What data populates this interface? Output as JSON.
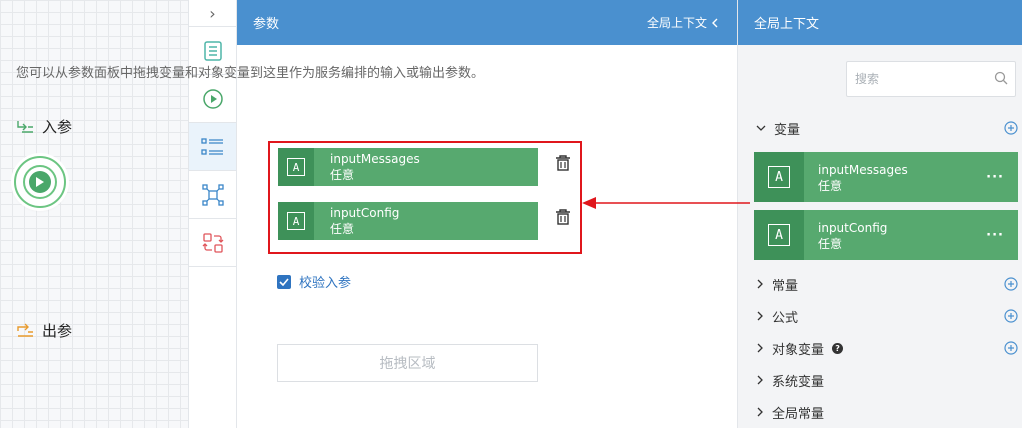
{
  "params_panel": {
    "title": "参数",
    "context_toggle": "全局上下文",
    "description": "您可以从参数面板中拖拽变量和对象变量到这里作为服务编排的输入或输出参数。",
    "input_section_label": "入参",
    "inputs": [
      {
        "name": "inputMessages",
        "type": "任意",
        "icon": "text-type-icon"
      },
      {
        "name": "inputConfig",
        "type": "任意",
        "icon": "text-type-icon"
      }
    ],
    "validate_label": "校验入参",
    "validate_checked": true,
    "output_section_label": "出参",
    "drop_zone_label": "拖拽区域"
  },
  "context_panel": {
    "title": "全局上下文",
    "search_placeholder": "搜索",
    "variables_label": "变量",
    "variables": [
      {
        "name": "inputMessages",
        "type": "任意"
      },
      {
        "name": "inputConfig",
        "type": "任意"
      }
    ],
    "more_label": "···",
    "categories": [
      {
        "label": "常量",
        "addable": true
      },
      {
        "label": "公式",
        "addable": true
      },
      {
        "label": "对象变量",
        "addable": true,
        "help": true
      },
      {
        "label": "系统变量",
        "addable": false
      },
      {
        "label": "全局常量",
        "addable": false
      }
    ],
    "help_glyph": "?"
  },
  "toolbar": {
    "collapse_glyph": "›",
    "items": [
      "list-icon",
      "play-icon",
      "params-icon",
      "transform-icon",
      "swap-icon"
    ],
    "active_index": 2
  },
  "colors": {
    "header": "#4a90cf",
    "card": "#57a96f",
    "card_icon_bg": "#3e9159",
    "highlight": "#e0161c",
    "link": "#2f74c0"
  }
}
